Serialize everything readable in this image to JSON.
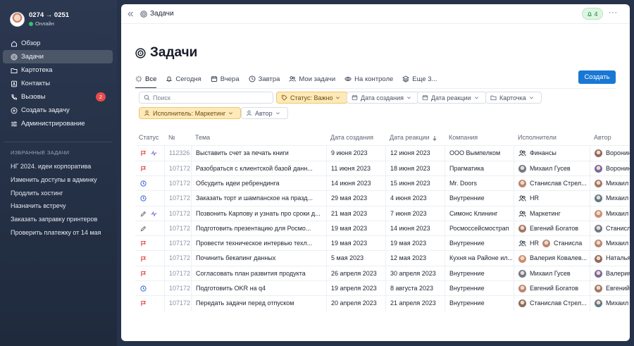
{
  "profile": {
    "name": "0274 → 0251",
    "status": "Онлайн"
  },
  "nav": [
    {
      "label": "Обзор",
      "icon": "home-icon",
      "active": false
    },
    {
      "label": "Задачи",
      "icon": "target-icon",
      "active": true
    },
    {
      "label": "Картотека",
      "icon": "folder-icon",
      "active": false
    },
    {
      "label": "Контакты",
      "icon": "contacts-icon",
      "active": false
    },
    {
      "label": "Вызовы",
      "icon": "phone-icon",
      "active": false,
      "badge": "2"
    },
    {
      "label": "Создать задачу",
      "icon": "plus-circle-icon",
      "active": false
    },
    {
      "label": "Администрирование",
      "icon": "sliders-icon",
      "active": false
    }
  ],
  "favorites": {
    "title": "ИЗБРАННЫЕ ЗАДАЧИ",
    "items": [
      "НГ 2024. идеи корпоратива",
      "Изменить доступы в админку",
      "Продлить хостинг",
      "Назначить встречу",
      "Заказать заправку принтеров",
      "Проверить платежку от 14 мая"
    ]
  },
  "topbar": {
    "breadcrumb": "Задачи",
    "notifications": "4",
    "more": "···"
  },
  "page": {
    "title": "Задачи",
    "create_label": "Создать"
  },
  "tabs": [
    {
      "label": "Все",
      "icon": "sparkle-icon",
      "active": true
    },
    {
      "label": "Сегодня",
      "icon": "bell-icon"
    },
    {
      "label": "Вчера",
      "icon": "calendar-icon"
    },
    {
      "label": "Завтра",
      "icon": "clock-icon"
    },
    {
      "label": "Мои задачи",
      "icon": "users-icon"
    },
    {
      "label": "На контроле",
      "icon": "eye-icon"
    },
    {
      "label": "Еще 3...",
      "icon": "layers-icon"
    }
  ],
  "filters": {
    "search_placeholder": "Поиск",
    "status": "Статус: Важно",
    "created": "Дата создания",
    "reaction": "Дата реакции",
    "card": "Карточка",
    "assignee": "Исполнитель: Маркетинг",
    "author": "Автор"
  },
  "table": {
    "headers": [
      "Статус",
      "№",
      "Тема",
      "Дата создания",
      "Дата реакции",
      "Компания",
      "Исполнители",
      "Автор"
    ],
    "rows": [
      {
        "icons": [
          "flag-icon",
          "pulse-icon"
        ],
        "num": "112326",
        "subject": "Выставить счет за печать книги",
        "created": "9 июня 2023",
        "reaction": "12 июня 2023",
        "company": "ООО Вымпелком",
        "assignee": "Финансы",
        "assignee_group": true,
        "author": "Воронин"
      },
      {
        "icons": [
          "flag-icon"
        ],
        "num": "107172",
        "subject": "Разобраться с клиентской базой данн...",
        "created": "11 июня 2023",
        "reaction": "18 июня 2023",
        "company": "Прагматика",
        "assignee": "Михаил Гусев",
        "assignee_group": false,
        "author": "Воронин"
      },
      {
        "icons": [
          "clock-icon"
        ],
        "num": "107172",
        "subject": "Обсудить идеи ребрендинга",
        "created": "14 июня 2023",
        "reaction": "15 июня 2023",
        "company": "Mr. Doors",
        "assignee": "Станислав Стрел...",
        "assignee_group": false,
        "author": "Михаил"
      },
      {
        "icons": [
          "clock-icon"
        ],
        "num": "107172",
        "subject": "Заказать торт и шампанское на празд...",
        "created": "29 мая 2023",
        "reaction": "4 июня 2023",
        "company": "Внутренние",
        "assignee": "HR",
        "assignee_group": true,
        "author": "Михаил"
      },
      {
        "icons": [
          "pencil-icon",
          "pulse-icon"
        ],
        "num": "107172",
        "subject": "Позвонить Карпову и узнать про сроки д...",
        "created": "21 мая 2023",
        "reaction": "7 июня 2023",
        "company": "Симонс Клининг",
        "assignee": "Маркетинг",
        "assignee_group": true,
        "author": "Михаил"
      },
      {
        "icons": [
          "pencil-icon"
        ],
        "num": "107172",
        "subject": "Подготовить презентацию для Росмо...",
        "created": "19 мая 2023",
        "reaction": "14 июня 2023",
        "company": "Росмоссейсмострап",
        "assignee": "Евгений Богатов",
        "assignee_group": false,
        "author": "Станисл"
      },
      {
        "icons": [
          "flag-icon"
        ],
        "num": "107172",
        "subject": "Провести техническое интервью техл...",
        "created": "19 мая 2023",
        "reaction": "19 мая 2023",
        "company": "Внутренние",
        "assignee": "HR",
        "assignee_group": true,
        "assignee_extra": "Станисла",
        "author": "Михаил"
      },
      {
        "icons": [
          "flag-icon"
        ],
        "num": "107172",
        "subject": "Починить бекапинг данных",
        "created": "5 мая 2023",
        "reaction": "12 мая 2023",
        "company": "Кухня на Районе ил...",
        "assignee": "Валерия Ковалев...",
        "assignee_group": false,
        "author": "Наталья"
      },
      {
        "icons": [
          "flag-icon"
        ],
        "num": "107172",
        "subject": "Согласовать план развития продукта",
        "created": "26 апреля 2023",
        "reaction": "30 апреля 2023",
        "company": "Внутренние",
        "assignee": "Михаил Гусев",
        "assignee_group": false,
        "author": "Валерия"
      },
      {
        "icons": [
          "clock-icon"
        ],
        "num": "107172",
        "subject": "Подготовить OKR на q4",
        "created": "19 апреля 2023",
        "reaction": "8 августа 2023",
        "company": "Внутренние",
        "assignee": "Евгений Богатов",
        "assignee_group": false,
        "author": "Евгений"
      },
      {
        "icons": [
          "flag-icon"
        ],
        "num": "107172",
        "subject": "Передать задачи перед отпуском",
        "created": "20 апреля 2023",
        "reaction": "21 апреля 2023",
        "company": "Внутренние",
        "assignee": "Станислав Стрел...",
        "assignee_group": false,
        "author": "Михаил"
      }
    ]
  },
  "colors": {
    "accent": "#1978d4",
    "flag": "#e03a3a",
    "clock": "#2f5fd0",
    "pulse": "#6b5bd6",
    "warn_bg": "#fde9b9",
    "badge": "#e74b4b"
  }
}
